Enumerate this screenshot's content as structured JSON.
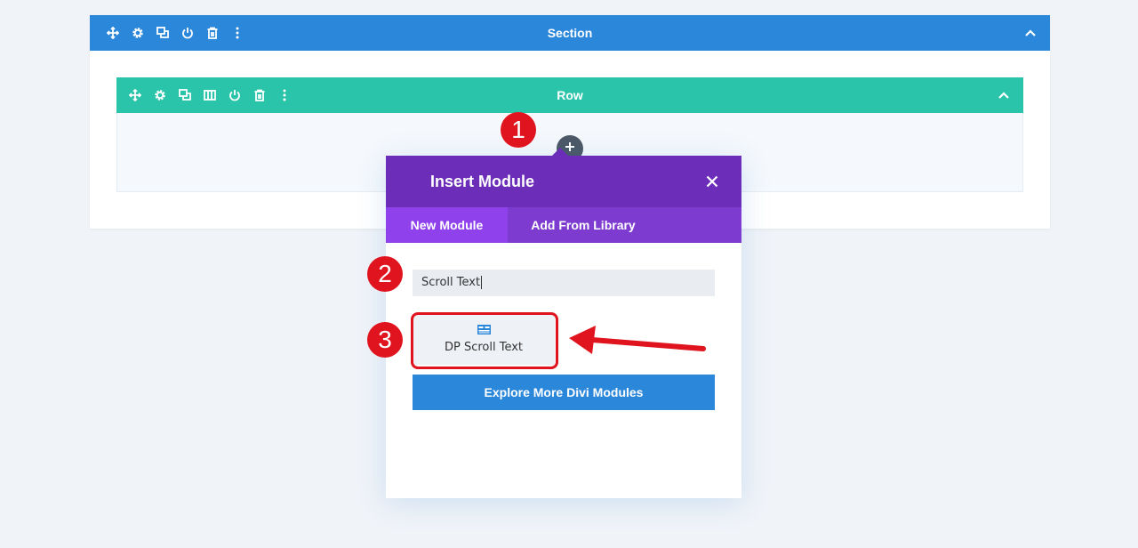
{
  "section": {
    "title": "Section",
    "toolbar_icons": [
      "move-icon",
      "gear-icon",
      "duplicate-icon",
      "power-icon",
      "trash-icon",
      "more-icon"
    ],
    "collapse_icon": "chevron-up-icon"
  },
  "row": {
    "title": "Row",
    "toolbar_icons": [
      "move-icon",
      "gear-icon",
      "duplicate-icon",
      "columns-icon",
      "power-icon",
      "trash-icon",
      "more-icon"
    ],
    "collapse_icon": "chevron-up-icon"
  },
  "modal": {
    "title": "Insert Module",
    "tabs": [
      {
        "label": "New Module",
        "active": true
      },
      {
        "label": "Add From Library",
        "active": false
      }
    ],
    "search": {
      "value": "Scroll Text",
      "placeholder": ""
    },
    "result_module": {
      "label": "DP Scroll Text",
      "icon": "scroll-text-module-icon"
    },
    "explore_button": "Explore More Divi Modules"
  },
  "annotations": {
    "step1": "1",
    "step2": "2",
    "step3": "3"
  },
  "colors": {
    "section_bar": "#2b87da",
    "row_bar": "#29c4a9",
    "modal_header": "#6c2eb9",
    "modal_tabs": "#7e3bd0",
    "annotation": "#e0141e"
  }
}
